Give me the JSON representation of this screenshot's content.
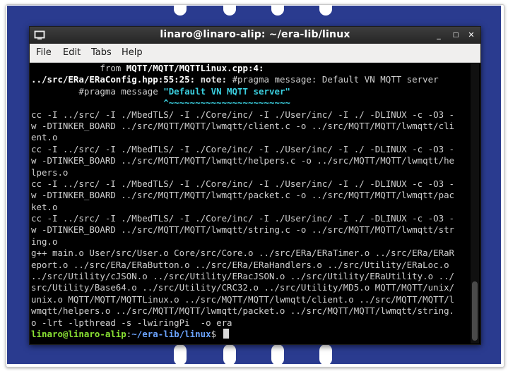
{
  "window": {
    "title": "linaro@linaro-alip: ~/era-lib/linux",
    "icon": "terminal-icon",
    "controls": {
      "minimize": "_",
      "maximize": "□",
      "close": "✕"
    }
  },
  "menu": {
    "items": [
      "File",
      "Edit",
      "Tabs",
      "Help"
    ]
  },
  "terminal": {
    "lines": [
      "             from MQTT/MQTT/MQTTLinux.cpp:4:",
      "../src/ERa/ERaConfig.hpp:55:25: note: #pragma message: Default VN MQTT server",
      "         #pragma message \"Default VN MQTT server\"",
      "                         ^~~~~~~~~~~~~~~~~~~~~~~~",
      "cc -I ../src/ -I ./MbedTLS/ -I ./Core/inc/ -I ./User/inc/ -I ./ -DLINUX -c -O3 -",
      "w -DTINKER_BOARD ../src/MQTT/MQTT/lwmqtt/client.c -o ../src/MQTT/MQTT/lwmqtt/cli",
      "ent.o",
      "cc -I ../src/ -I ./MbedTLS/ -I ./Core/inc/ -I ./User/inc/ -I ./ -DLINUX -c -O3 -",
      "w -DTINKER_BOARD ../src/MQTT/MQTT/lwmqtt/helpers.c -o ../src/MQTT/MQTT/lwmqtt/he",
      "lpers.o",
      "cc -I ../src/ -I ./MbedTLS/ -I ./Core/inc/ -I ./User/inc/ -I ./ -DLINUX -c -O3 -",
      "w -DTINKER_BOARD ../src/MQTT/MQTT/lwmqtt/packet.c -o ../src/MQTT/MQTT/lwmqtt/pac",
      "ket.o",
      "cc -I ../src/ -I ./MbedTLS/ -I ./Core/inc/ -I ./User/inc/ -I ./ -DLINUX -c -O3 -",
      "w -DTINKER_BOARD ../src/MQTT/MQTT/lwmqtt/string.c -o ../src/MQTT/MQTT/lwmqtt/str",
      "ing.o",
      "g++ main.o User/src/User.o Core/src/Core.o ../src/ERa/ERaTimer.o ../src/ERa/ERaR",
      "eport.o ../src/ERa/ERaButton.o ../src/ERa/ERaHandlers.o ../src/Utility/ERaLoc.o",
      "../src/Utility/cJSON.o ../src/Utility/ERacJSON.o ../src/Utility/ERaUtility.o ../",
      "src/Utility/Base64.o ../src/Utility/CRC32.o ../src/Utility/MD5.o MQTT/MQTT/unix/",
      "unix.o MQTT/MQTT/MQTTLinux.o ../src/MQTT/MQTT/lwmqtt/client.o ../src/MQTT/MQTT/l",
      "wmqtt/helpers.o ../src/MQTT/MQTT/lwmqtt/packet.o ../src/MQTT/MQTT/lwmqtt/string.",
      "o -lrt -lpthread -s -lwiringPi  -o era"
    ],
    "segments": {
      "line1_prefix": "             from ",
      "line1_bold": "MQTT/MQTT/MQTTLinux.cpp:4:",
      "line2_bold": "../src/ERa/ERaConfig.hpp:55:25: ",
      "line2_note": "note: ",
      "line2_rest": "#pragma message: Default VN MQTT server",
      "line3_prefix": "         #pragma message ",
      "line3_cyan": "\"Default VN MQTT server\"",
      "line4_prefix": "                         ",
      "line4_cyan": "^~~~~~~~~~~~~~~~~~~~~~~~"
    },
    "prompt": {
      "user": "linaro@linaro-alip",
      "sep": ":",
      "path": "~/era-lib/linux",
      "symbol": "$ "
    }
  },
  "colors": {
    "desktop": "#2a3b8f",
    "cyan": "#3bd0e0",
    "prompt_user": "#8ae234",
    "prompt_path": "#6ba4ff"
  }
}
